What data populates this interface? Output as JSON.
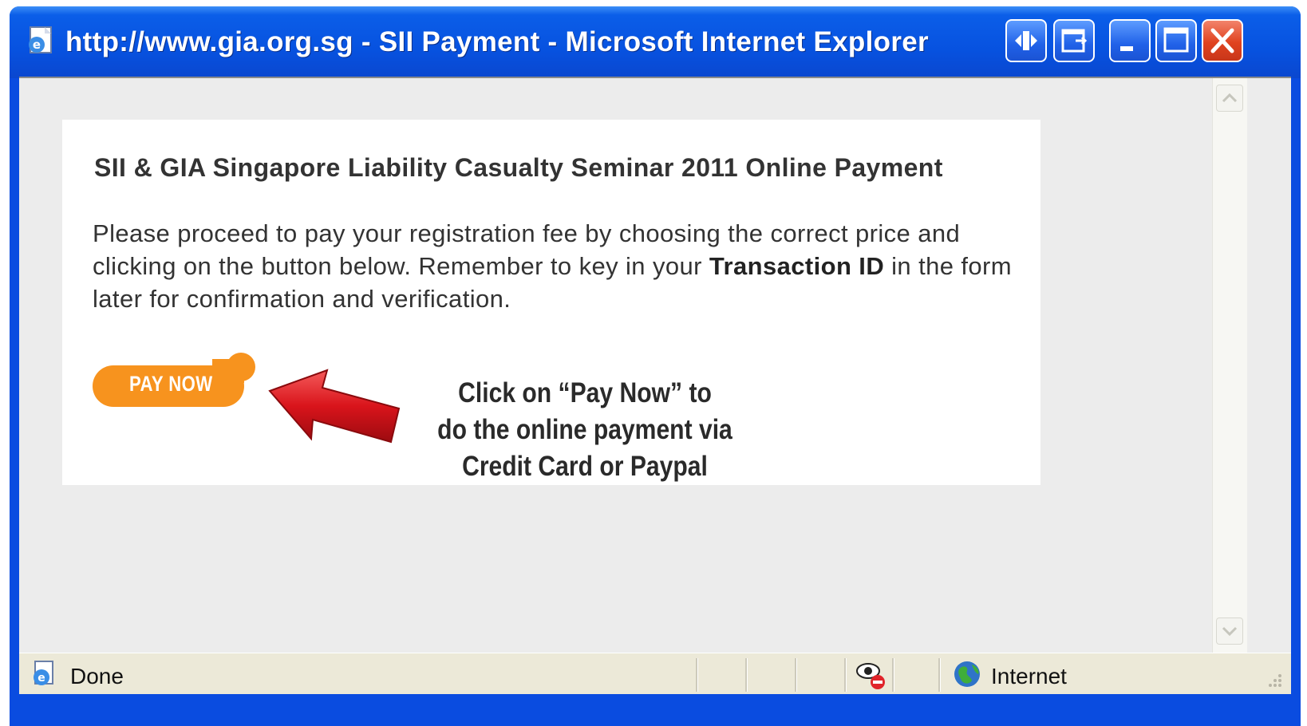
{
  "window": {
    "title": "http://www.gia.org.sg - SII Payment - Microsoft Internet Explorer",
    "icon": "ie-page-icon",
    "buttons": [
      "resize-arrows-icon",
      "restore-window-icon",
      "minimize-icon",
      "maximize-icon",
      "close-icon"
    ]
  },
  "page": {
    "heading": "SII & GIA Singapore Liability Casualty Seminar 2011 Online Payment",
    "instructions_before": "Please proceed to pay your registration fee by choosing the correct price and clicking on the button below. Remember to key in your ",
    "instructions_bold": "Transaction ID",
    "instructions_after": " in the form later for confirmation and verification.",
    "pay_button_label": "PAY NOW",
    "hint_line1": "Click on “Pay Now” to",
    "hint_line2": "do the online payment via",
    "hint_line3": "Credit Card or Paypal"
  },
  "statusbar": {
    "status": "Done",
    "zone": "Internet"
  },
  "colors": {
    "titlebar_blue": "#0752e0",
    "pay_button_orange": "#f7931e",
    "arrow_red": "#d9141b",
    "client_gray": "#ececec"
  }
}
